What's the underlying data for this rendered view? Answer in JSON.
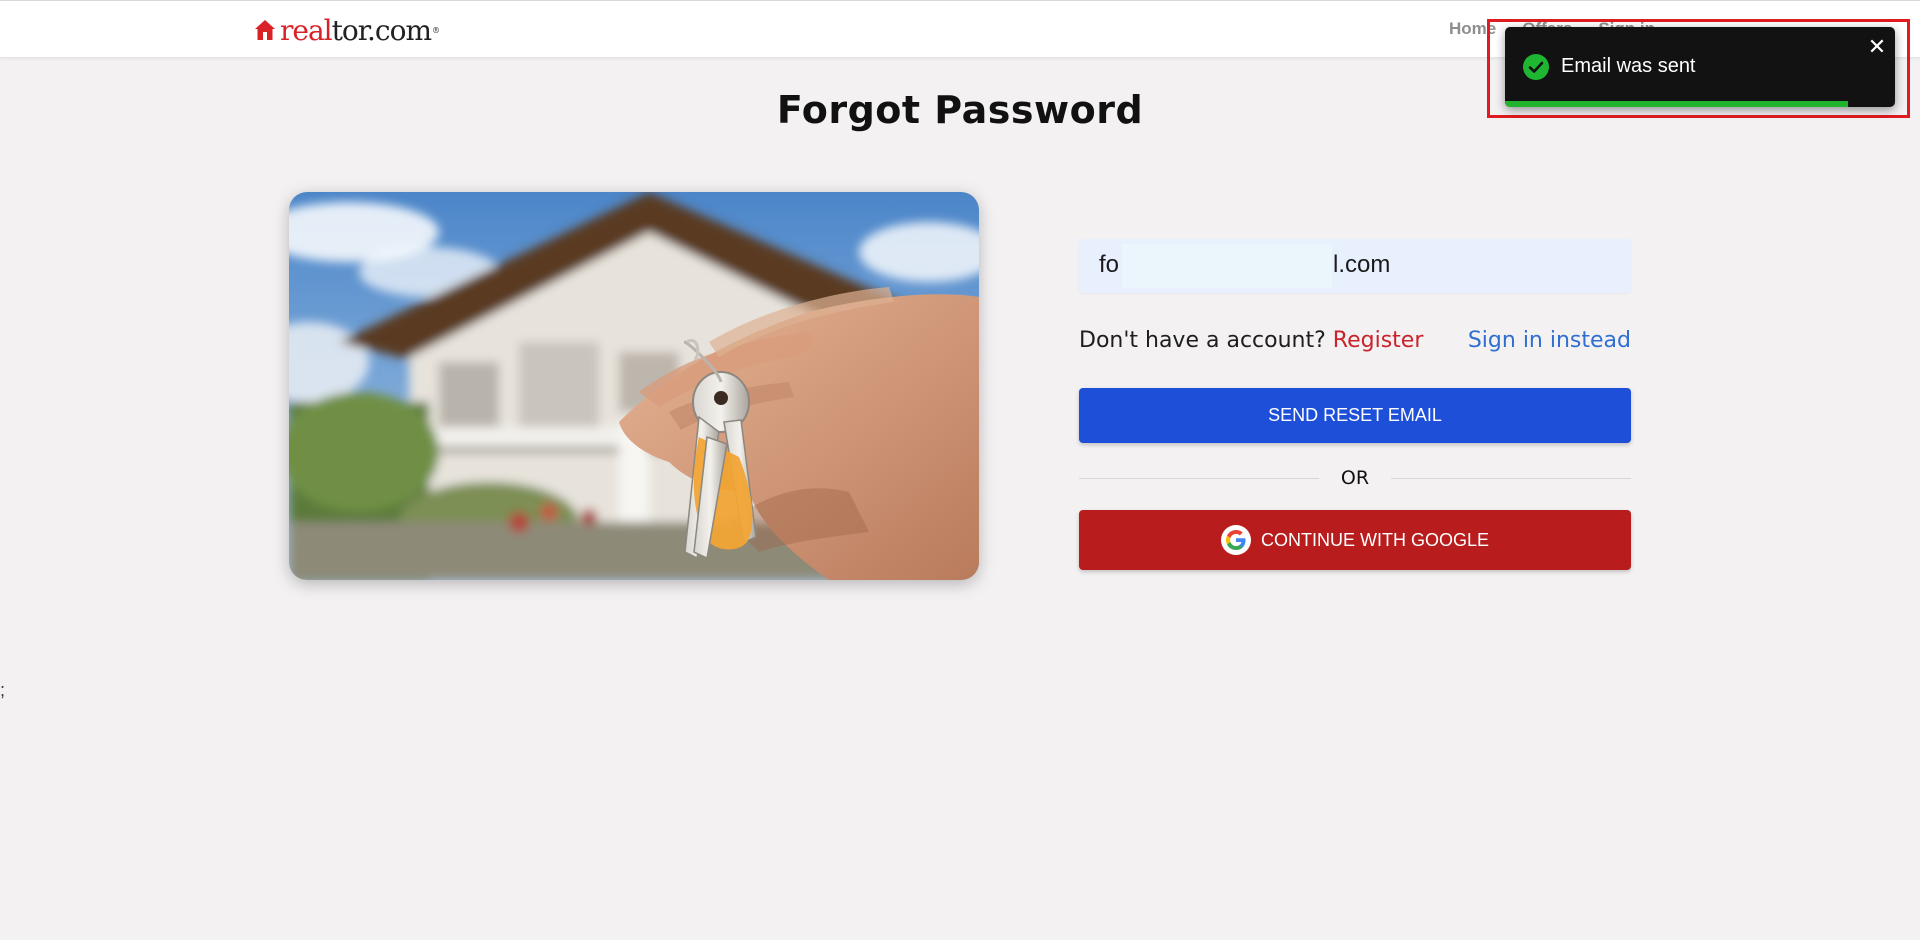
{
  "header": {
    "logo_red": "real",
    "logo_dark": "tor.com",
    "nav": [
      "Home",
      "Offers",
      "Sign in"
    ]
  },
  "page": {
    "title": "Forgot Password"
  },
  "form": {
    "email_prefix": "fo",
    "email_suffix": "l.com",
    "no_account_text": "Don't have a account?",
    "register_link": "Register",
    "signin_link": "Sign in instead",
    "send_button": "SEND RESET EMAIL",
    "divider_text": "OR",
    "google_button": "CONTINUE WITH GOOGLE"
  },
  "stray_text": ";",
  "toast": {
    "message": "Email was sent",
    "close_symbol": "✕",
    "progress": 0.88,
    "colors": {
      "background": "#121212",
      "success": "#22b32e",
      "outline": "#e01b22"
    }
  },
  "colors": {
    "primary": "#1d4fd9",
    "google_red": "#b91c1c",
    "link_red": "#c9232b",
    "link_blue": "#2f6fd1",
    "background": "#f3f1f2"
  }
}
